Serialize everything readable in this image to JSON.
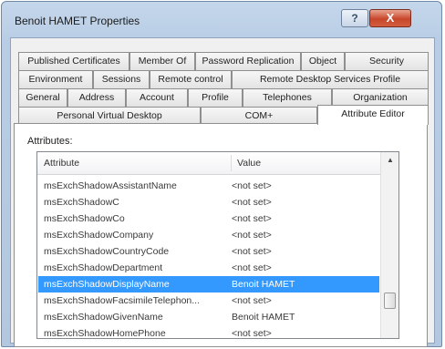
{
  "window": {
    "title": "Benoit HAMET Properties"
  },
  "titlebar_buttons": {
    "help_label": "?",
    "close_label": "X"
  },
  "tabs": {
    "row1": [
      "Published Certificates",
      "Member Of",
      "Password Replication",
      "Object",
      "Security"
    ],
    "row2": [
      "Environment",
      "Sessions",
      "Remote control",
      "Remote Desktop Services Profile"
    ],
    "row3": [
      "General",
      "Address",
      "Account",
      "Profile",
      "Telephones",
      "Organization"
    ],
    "row4": [
      "Personal Virtual Desktop",
      "COM+",
      "Attribute Editor"
    ],
    "active": "Attribute Editor"
  },
  "attributes": {
    "label": "Attributes:",
    "columns": {
      "attribute": "Attribute",
      "value": "Value"
    },
    "rows": [
      {
        "name": "msExchShadowAssistantName",
        "value": "<not set>"
      },
      {
        "name": "msExchShadowC",
        "value": "<not set>"
      },
      {
        "name": "msExchShadowCo",
        "value": "<not set>"
      },
      {
        "name": "msExchShadowCompany",
        "value": "<not set>"
      },
      {
        "name": "msExchShadowCountryCode",
        "value": "<not set>"
      },
      {
        "name": "msExchShadowDepartment",
        "value": "<not set>"
      },
      {
        "name": "msExchShadowDisplayName",
        "value": "Benoit HAMET",
        "selected": true
      },
      {
        "name": "msExchShadowFacsimileTelephon...",
        "value": "<not set>"
      },
      {
        "name": "msExchShadowGivenName",
        "value": "Benoit HAMET"
      },
      {
        "name": "msExchShadowHomePhone",
        "value": "<not set>"
      }
    ]
  },
  "scrollbar": {
    "up_arrow": "▲"
  }
}
